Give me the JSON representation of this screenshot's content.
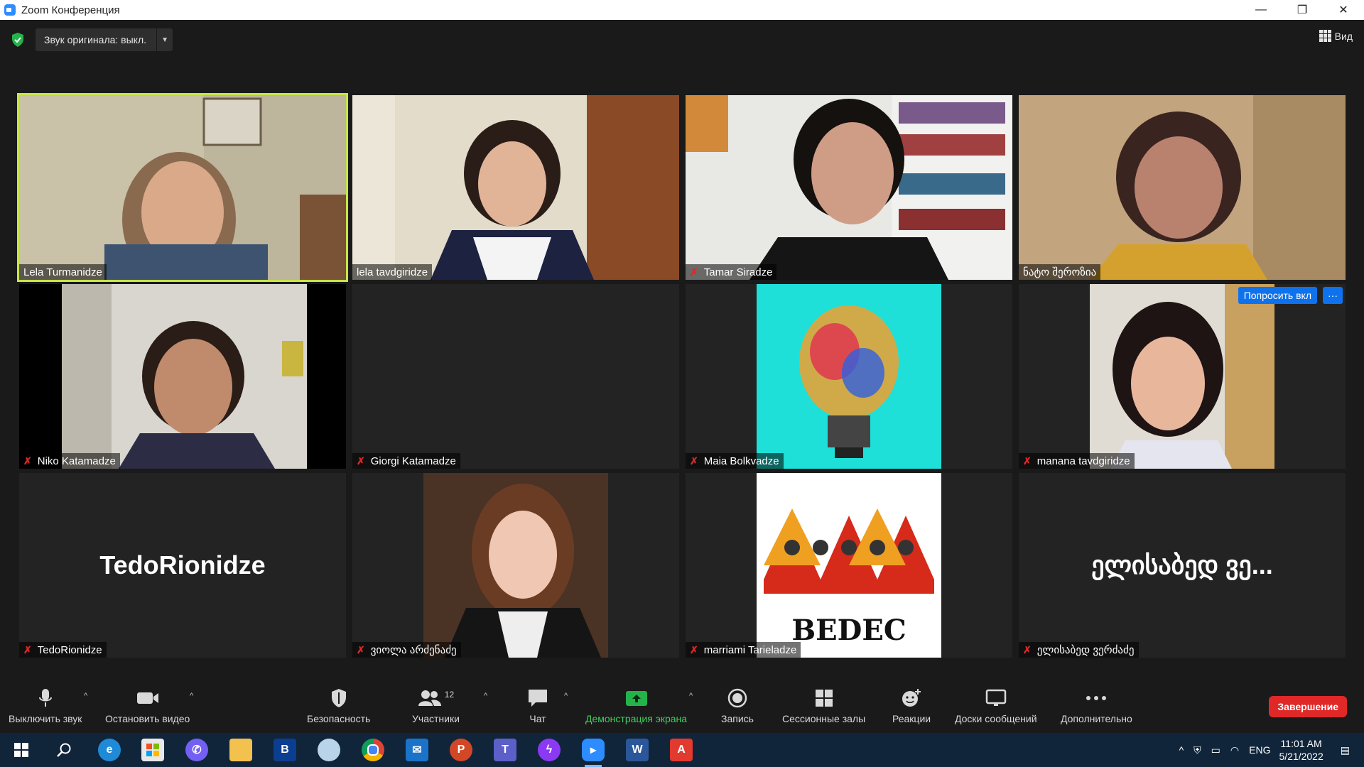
{
  "window": {
    "title": "Zoom Конференция",
    "controls": [
      "—",
      "❐",
      "✕"
    ]
  },
  "topbar": {
    "original_sound": "Звук оригинала: выкл.",
    "view_label": "Вид"
  },
  "tiles": [
    {
      "name": "Lela Turmanidze",
      "muted": false,
      "active": true
    },
    {
      "name": "lela tavdgiridze",
      "muted": false
    },
    {
      "name": "Tamar Siradze",
      "muted": true
    },
    {
      "name": "ნატო შეროზია",
      "muted": false
    },
    {
      "name": "Niko Katamadze",
      "muted": true
    },
    {
      "name": "Giorgi Katamadze",
      "muted": true
    },
    {
      "name": "Maia Bolkvadze",
      "muted": true
    },
    {
      "name": "manana tavdgiridze",
      "muted": true,
      "request_label": "Попросить вкл",
      "more_label": "···"
    },
    {
      "name": "TedoRionidze",
      "muted": true,
      "display_name": "TedoRionidze"
    },
    {
      "name": "ვიოლა არძენაძე",
      "muted": true
    },
    {
      "name": "marriami Tarieladze",
      "muted": true,
      "logo_text": "BEDEC"
    },
    {
      "name": "ელისაბედ ვერძაძე",
      "muted": true,
      "display_name": "ელისაბედ ვე..."
    }
  ],
  "toolbar": {
    "mute": "Выключить звук",
    "video": "Остановить видео",
    "security": "Безопасность",
    "participants": "Участники",
    "participants_count": "12",
    "chat": "Чат",
    "share": "Демонстрация экрана",
    "record": "Запись",
    "breakout": "Сессионные залы",
    "reactions": "Реакции",
    "whiteboards": "Доски сообщений",
    "more": "Дополнительно",
    "end": "Завершение"
  },
  "taskbar": {
    "lang": "ENG",
    "time": "11:01 AM",
    "date": "5/21/2022",
    "apps": [
      "start",
      "search",
      "edge",
      "store",
      "viber",
      "explorer",
      "booking",
      "paint",
      "chrome",
      "mail",
      "powerpoint",
      "teams",
      "messenger",
      "zoom",
      "word",
      "pdf"
    ]
  },
  "colors": {
    "active_speaker": "#c7e646",
    "end_button": "#e02828",
    "share_green": "#3ecf5e",
    "request_blue": "#0e72ed"
  }
}
